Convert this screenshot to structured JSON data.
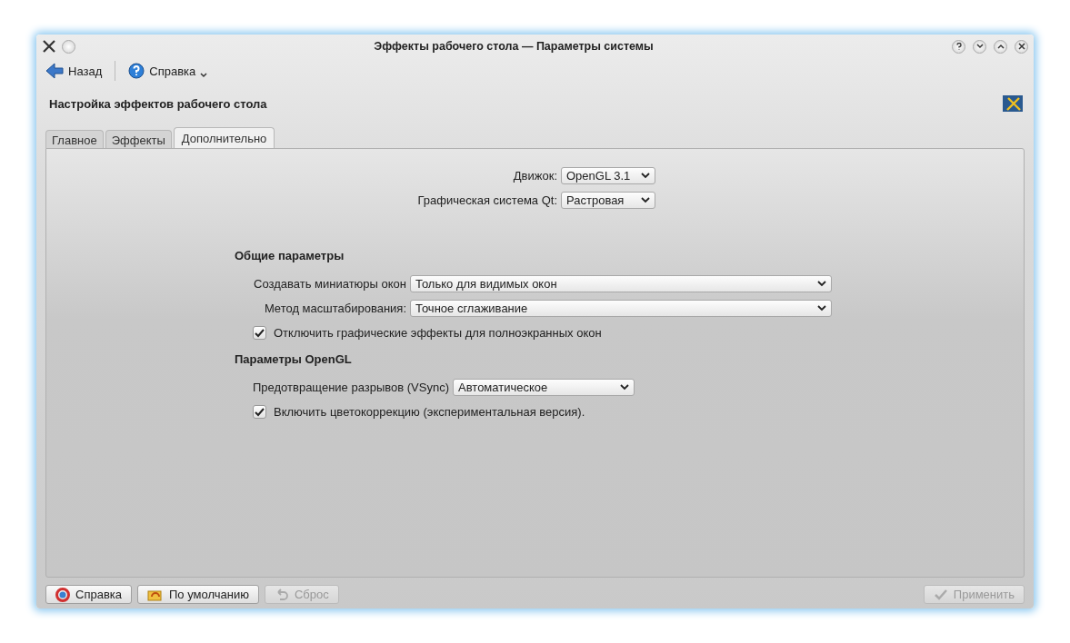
{
  "window": {
    "title": "Эффекты рабочего стола — Параметры системы"
  },
  "toolbar": [
    {
      "kind": "back",
      "label": "Назад"
    },
    {
      "kind": "help",
      "label": "Справка"
    }
  ],
  "heading": "Настройка эффектов рабочего стола",
  "tabs": [
    {
      "label": "Главное",
      "selected": false
    },
    {
      "label": "Эффекты",
      "selected": false
    },
    {
      "label": "Дополнительно",
      "selected": true
    }
  ],
  "top_fields": [
    {
      "label": "Движок:",
      "value": "OpenGL 3.1"
    },
    {
      "label": "Графическая система Qt:",
      "value": "Растровая"
    }
  ],
  "general": {
    "title": "Общие параметры",
    "rows": [
      {
        "kind": "combo",
        "label": "Создавать миниатюры окон",
        "value": "Только для видимых окон"
      },
      {
        "kind": "combo",
        "label": "Метод масштабирования:",
        "value": "Точное сглаживание"
      },
      {
        "kind": "check",
        "label": "Отключить графические эффекты для полноэкранных окон",
        "checked": true
      }
    ]
  },
  "opengl": {
    "title": "Параметры OpenGL",
    "rows": [
      {
        "kind": "shortcombo",
        "label": "Предотвращение разрывов (VSync)",
        "value": "Автоматическое"
      },
      {
        "kind": "check",
        "label": "Включить цветокоррекцию (экспериментальная версия).",
        "checked": true
      }
    ]
  },
  "buttons": [
    {
      "kind": "help",
      "label": "Справка",
      "disabled": false
    },
    {
      "kind": "defaults",
      "label": "По умолчанию",
      "disabled": false
    },
    {
      "kind": "reset",
      "label": "Сброс",
      "disabled": true
    },
    {
      "kind": "apply",
      "label": "Применить",
      "disabled": true
    }
  ]
}
